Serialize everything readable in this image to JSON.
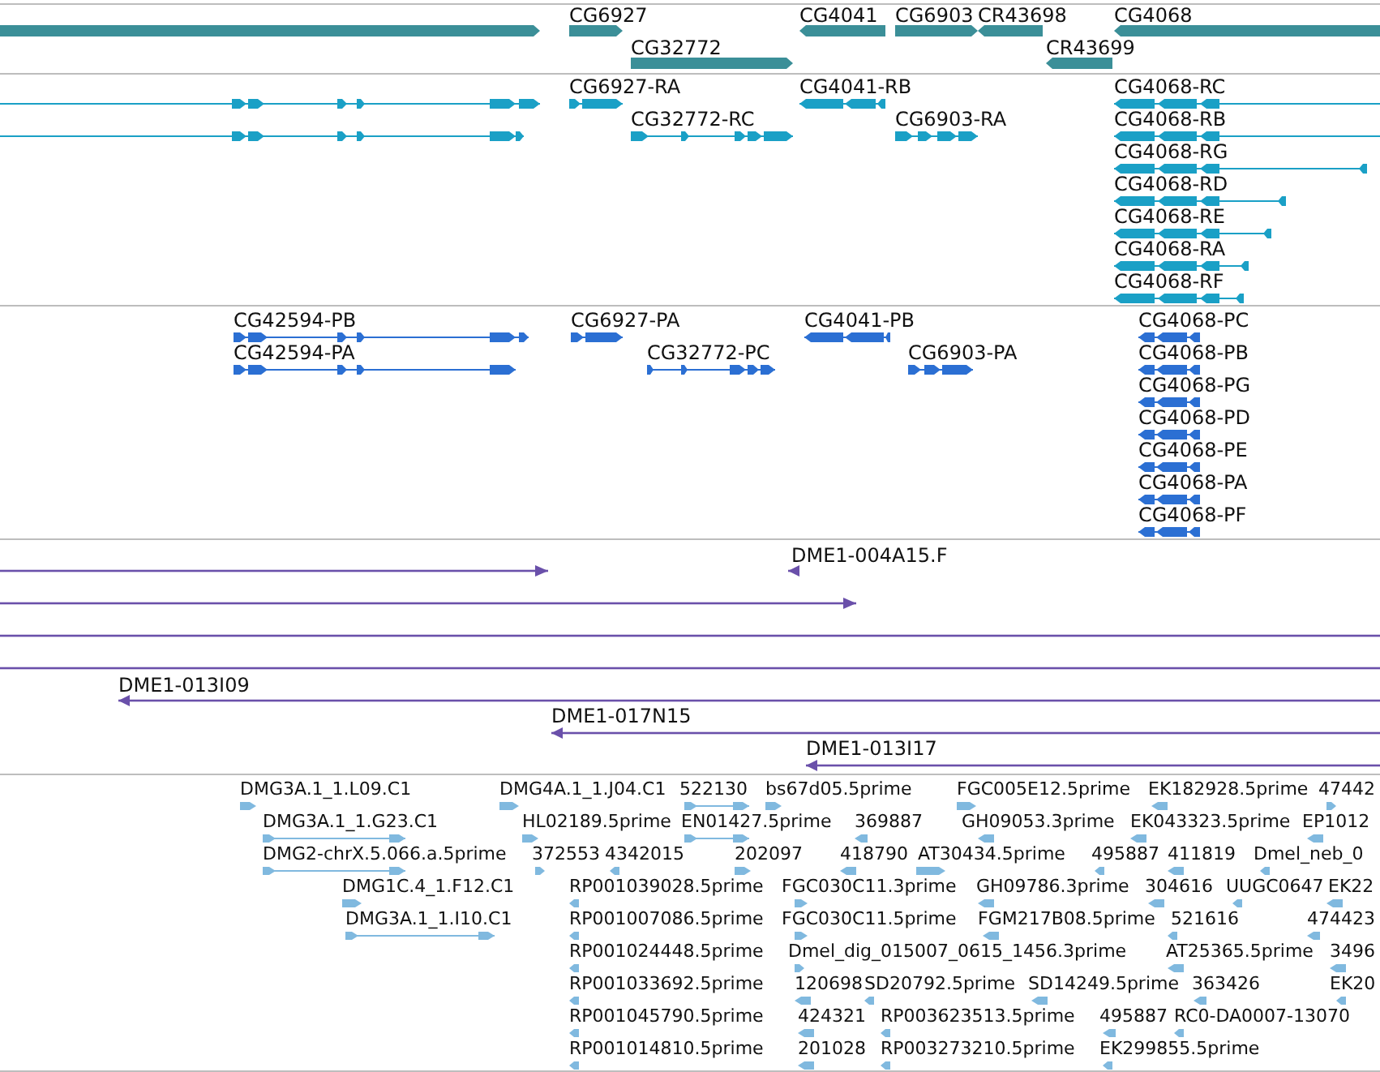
{
  "tracks": [
    {
      "kind": "gene",
      "features": [
        {
          "reverse": false
        },
        {
          "label": "CG6927",
          "reverse": false
        },
        {
          "label": "CG32772",
          "reverse": false
        },
        {
          "label": "CG4041",
          "reverse": true
        },
        {
          "label": "CG6903",
          "reverse": false
        },
        {
          "label": "CR43698",
          "reverse": true
        },
        {
          "label": "CR43699",
          "reverse": true
        },
        {
          "label": "CG4068",
          "reverse": true
        }
      ]
    },
    {
      "kind": "transcript",
      "features": [
        {
          "reverse": false
        },
        {
          "reverse": false
        },
        {
          "label": "CG6927-RA",
          "reverse": false
        },
        {
          "label": "CG32772-RC",
          "reverse": false
        },
        {
          "label": "CG4041-RB",
          "reverse": true
        },
        {
          "label": "CG6903-RA",
          "reverse": false
        },
        {
          "label": "CG4068-RC",
          "reverse": true
        },
        {
          "label": "CG4068-RB",
          "reverse": true
        },
        {
          "label": "CG4068-RG",
          "reverse": true
        },
        {
          "label": "CG4068-RD",
          "reverse": true
        },
        {
          "label": "CG4068-RE",
          "reverse": true
        },
        {
          "label": "CG4068-RA",
          "reverse": true
        },
        {
          "label": "CG4068-RF",
          "reverse": true
        }
      ]
    },
    {
      "kind": "protein",
      "features": [
        {
          "label": "CG42594-PB",
          "reverse": false
        },
        {
          "label": "CG42594-PA",
          "reverse": false
        },
        {
          "label": "CG6927-PA",
          "reverse": false
        },
        {
          "label": "CG32772-PC",
          "reverse": false
        },
        {
          "label": "CG4041-PB",
          "reverse": true
        },
        {
          "label": "CG6903-PA",
          "reverse": false
        },
        {
          "label": "CG4068-PC",
          "reverse": true
        },
        {
          "label": "CG4068-PB",
          "reverse": true
        },
        {
          "label": "CG4068-PG",
          "reverse": true
        },
        {
          "label": "CG4068-PD",
          "reverse": true
        },
        {
          "label": "CG4068-PE",
          "reverse": true
        },
        {
          "label": "CG4068-PA",
          "reverse": true
        },
        {
          "label": "CG4068-PF",
          "reverse": true
        }
      ]
    },
    {
      "kind": "clone",
      "features": [
        {
          "reverse": false
        },
        {
          "label": "DME1-004A15.F",
          "reverse": true
        },
        {
          "reverse": false
        },
        {
          "reverse": false
        },
        {
          "reverse": false
        },
        {
          "label": "DME1-013I09",
          "reverse": true
        },
        {
          "label": "DME1-017N15",
          "reverse": true
        },
        {
          "label": "DME1-013I17",
          "reverse": true
        }
      ]
    },
    {
      "kind": "est",
      "features": [
        {
          "label": "DMG3A.1_1.L09.C1",
          "reverse": false
        },
        {
          "label": "DMG4A.1_1.J04.C1",
          "reverse": false
        },
        {
          "label": "522130",
          "reverse": false
        },
        {
          "label": "bs67d05.5prime",
          "reverse": false
        },
        {
          "label": "FGC005E12.5prime",
          "reverse": false
        },
        {
          "label": "EK182928.5prime",
          "reverse": true
        },
        {
          "label": "47442",
          "reverse": false
        },
        {
          "label": "DMG3A.1_1.G23.C1",
          "reverse": false
        },
        {
          "label": "HL02189.5prime",
          "reverse": false
        },
        {
          "label": "EN01427.5prime",
          "reverse": false
        },
        {
          "label": "369887",
          "reverse": true
        },
        {
          "label": "GH09053.3prime",
          "reverse": true
        },
        {
          "label": "EK043323.5prime",
          "reverse": true
        },
        {
          "label": "EP1012",
          "reverse": true
        },
        {
          "label": "DMG2-chrX.5.066.a.5prime",
          "reverse": false
        },
        {
          "label": "372553",
          "reverse": false
        },
        {
          "label": "4342015",
          "reverse": true
        },
        {
          "label": "202097",
          "reverse": false
        },
        {
          "label": "418790",
          "reverse": true
        },
        {
          "label": "AT30434.5prime",
          "reverse": false
        },
        {
          "label": "495887",
          "reverse": true
        },
        {
          "label": "411819",
          "reverse": true
        },
        {
          "label": "Dmel_neb_0",
          "reverse": true
        },
        {
          "label": "DMG1C.4_1.F12.C1",
          "reverse": false
        },
        {
          "label": "RP001039028.5prime",
          "reverse": true
        },
        {
          "label": "FGC030C11.3prime",
          "reverse": false
        },
        {
          "label": "GH09786.3prime",
          "reverse": true
        },
        {
          "label": "304616",
          "reverse": true
        },
        {
          "label": "UUGC0647",
          "reverse": true
        },
        {
          "label": "EK22",
          "reverse": true
        },
        {
          "label": "DMG3A.1_1.I10.C1",
          "reverse": false
        },
        {
          "label": "RP001007086.5prime",
          "reverse": true
        },
        {
          "label": "FGC030C11.5prime",
          "reverse": false
        },
        {
          "label": "FGM217B08.5prime",
          "reverse": true
        },
        {
          "label": "521616",
          "reverse": true
        },
        {
          "label": "474423",
          "reverse": true
        },
        {
          "label": "RP001024448.5prime",
          "reverse": true
        },
        {
          "label": "Dmel_dig_015007_0615_1456.3prime",
          "reverse": false
        },
        {
          "label": "AT25365.5prime",
          "reverse": true
        },
        {
          "label": "3496",
          "reverse": true
        },
        {
          "label": "RP001033692.5prime",
          "reverse": true
        },
        {
          "label": "120698",
          "reverse": true
        },
        {
          "label": "SD20792.5prime",
          "reverse": true
        },
        {
          "label": "SD14249.5prime",
          "reverse": true
        },
        {
          "label": "363426",
          "reverse": true
        },
        {
          "label": "EK20",
          "reverse": true
        },
        {
          "label": "RP001045790.5prime",
          "reverse": true
        },
        {
          "label": "424321",
          "reverse": true
        },
        {
          "label": "RP003623513.5prime",
          "reverse": true
        },
        {
          "label": "495887",
          "reverse": true
        },
        {
          "label": "RC0-DA0007-13070",
          "reverse": true
        },
        {
          "label": "RP001014810.5prime",
          "reverse": true
        },
        {
          "label": "201028",
          "reverse": true
        },
        {
          "label": "RP003273210.5prime",
          "reverse": true
        },
        {
          "label": "EK299855.5prime",
          "reverse": true
        }
      ]
    }
  ]
}
